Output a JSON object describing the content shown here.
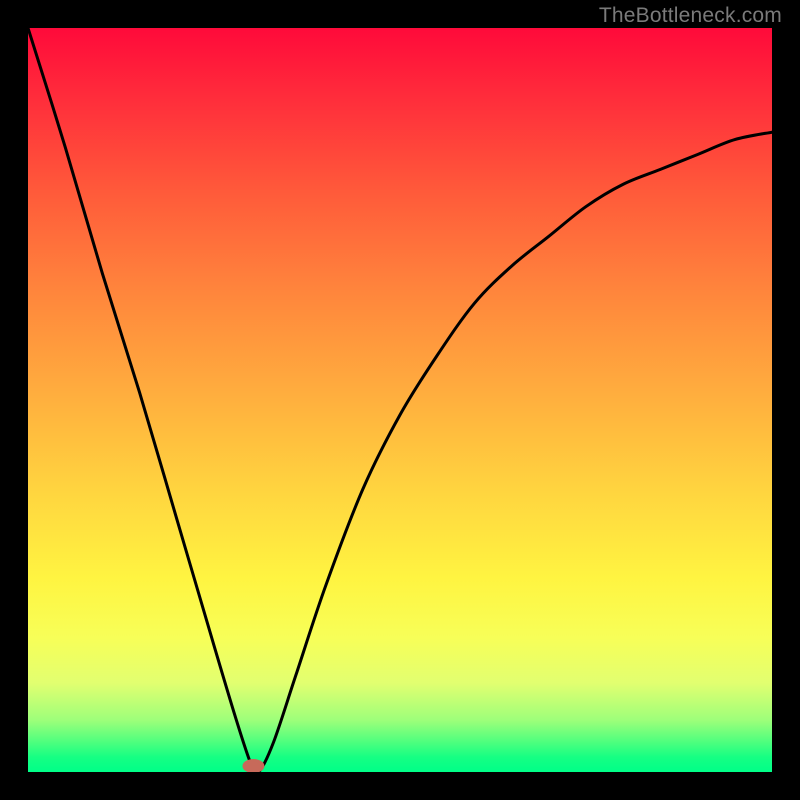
{
  "attribution": "TheBottleneck.com",
  "chart_data": {
    "type": "line",
    "title": "",
    "xlabel": "",
    "ylabel": "",
    "ylim": [
      0,
      100
    ],
    "xlim": [
      0,
      100
    ],
    "series": [
      {
        "name": "curve",
        "x": [
          0,
          5,
          10,
          15,
          20,
          25,
          28,
          30,
          31,
          33,
          36,
          40,
          45,
          50,
          55,
          60,
          65,
          70,
          75,
          80,
          85,
          90,
          95,
          100
        ],
        "values": [
          100,
          84,
          67,
          51,
          34,
          17,
          7,
          1,
          0,
          4,
          13,
          25,
          38,
          48,
          56,
          63,
          68,
          72,
          76,
          79,
          81,
          83,
          85,
          86
        ]
      }
    ],
    "marker": {
      "x": 30.3,
      "y": 0.8,
      "color": "#c76a5a"
    },
    "gradient_stops": [
      {
        "pct": 0,
        "color": "#ff0a3a"
      },
      {
        "pct": 50,
        "color": "#ffb03e"
      },
      {
        "pct": 75,
        "color": "#fff441"
      },
      {
        "pct": 100,
        "color": "#00ff88"
      }
    ]
  }
}
